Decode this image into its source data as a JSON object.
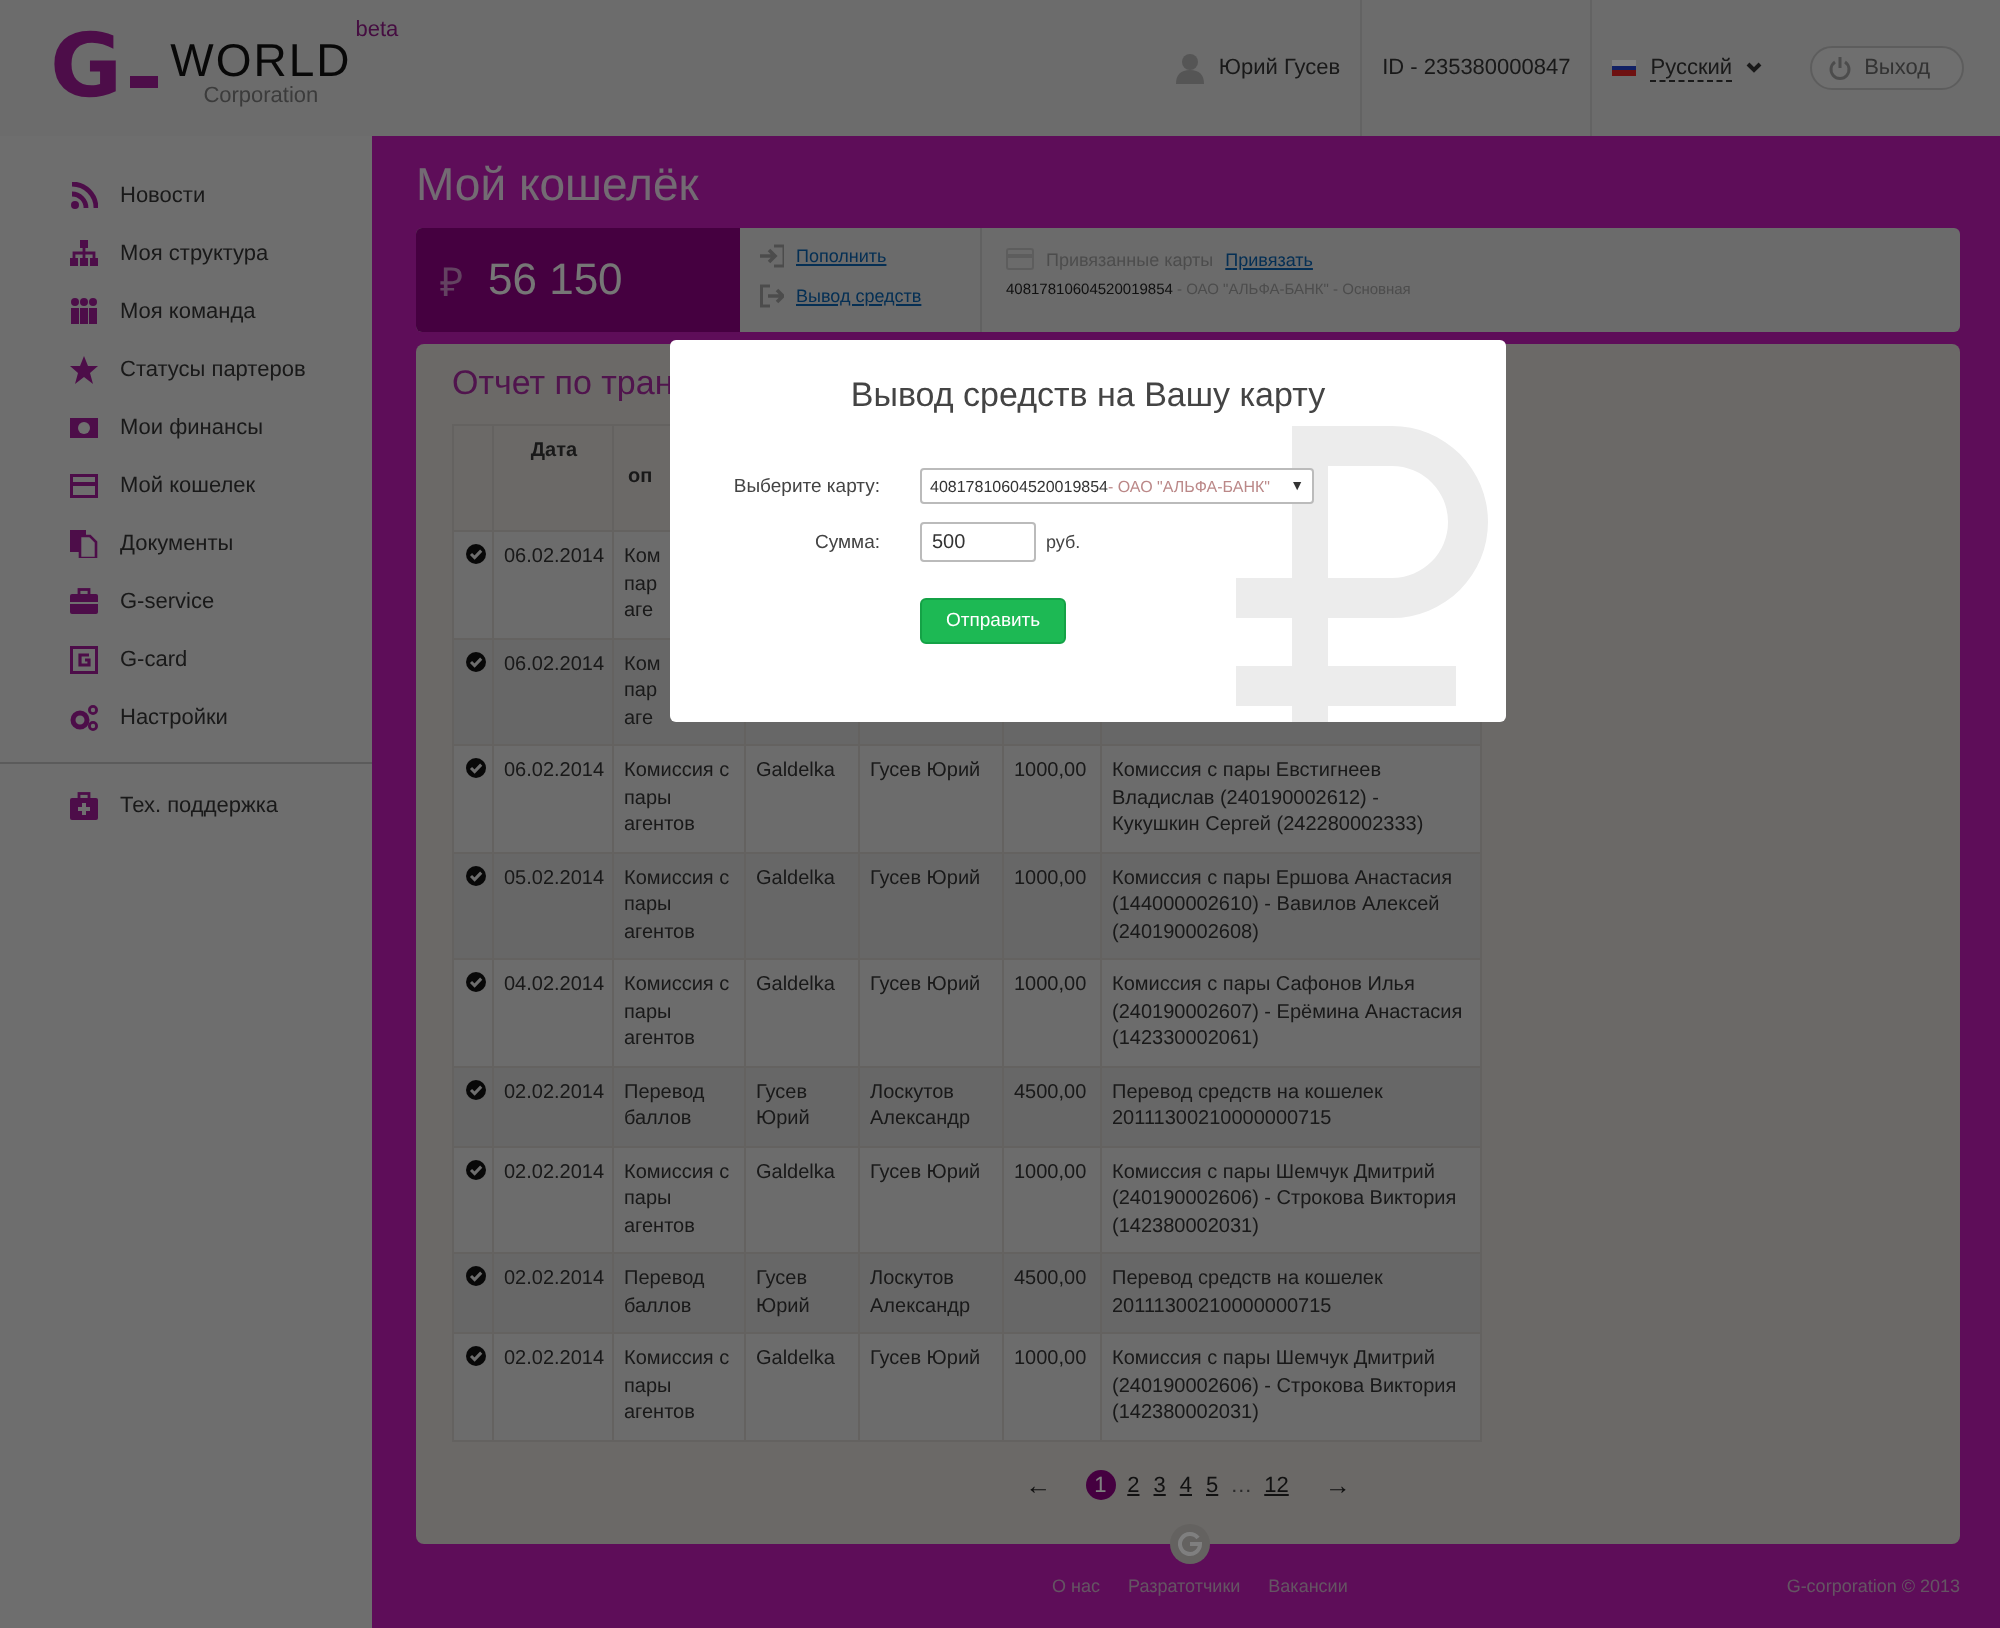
{
  "header": {
    "logo": {
      "letter": "G",
      "name": "WORLD",
      "subtitle": "Corporation",
      "badge": "beta"
    },
    "user": "Юрий Гусев",
    "id": "ID - 235380000847",
    "language": "Русский",
    "logout": "Выход"
  },
  "sidebar": {
    "items": [
      {
        "label": "Новости"
      },
      {
        "label": "Моя структура"
      },
      {
        "label": "Моя команда"
      },
      {
        "label": "Статусы партеров"
      },
      {
        "label": "Мои финансы"
      },
      {
        "label": "Мой кошелек"
      },
      {
        "label": "Документы"
      },
      {
        "label": "G-service"
      },
      {
        "label": "G-card"
      },
      {
        "label": "Настройки"
      }
    ],
    "support": "Тех. поддержка"
  },
  "page_title": "Мой кошелёк",
  "balance": {
    "currency": "₽",
    "amount": "56 150"
  },
  "actions": [
    "Пополнить",
    "Вывод средств"
  ],
  "cards": {
    "label": "Привязанные карты",
    "link": "Привязать",
    "number": "40817810604520019854",
    "details": " - ОАО \"АЛЬФА-БАНК\" - Основная"
  },
  "report": {
    "title": "Отчет по тран",
    "columns": [
      "Дата",
      "оп"
    ],
    "rows": [
      {
        "date": "06.02.2014",
        "operation": "Ком\nпар\nаге"
      },
      {
        "date": "06.02.2014",
        "operation": "Ком\nпар\nаге"
      },
      {
        "date": "06.02.2014",
        "operation": "Комиссия с пары агентов",
        "from": "Galdelka",
        "to": "Гусев Юрий",
        "amount": "1000,00",
        "comment": "Комиссия с пары Евстигнеев Владислав (240190002612) - Кукушкин Сергей (242280002333)"
      },
      {
        "date": "05.02.2014",
        "operation": "Комиссия с пары агентов",
        "from": "Galdelka",
        "to": "Гусев Юрий",
        "amount": "1000,00",
        "comment": "Комиссия с пары Ершова Анастасия (144000002610) - Вавилов Алексей (240190002608)"
      },
      {
        "date": "04.02.2014",
        "operation": "Комиссия с пары агентов",
        "from": "Galdelka",
        "to": "Гусев Юрий",
        "amount": "1000,00",
        "comment": "Комиссия с пары Сафонов Илья (240190002607) - Ерёмина Анастасия (142330002061)"
      },
      {
        "date": "02.02.2014",
        "operation": "Перевод баллов",
        "from": "Гусев Юрий",
        "to": "Лоскутов Александр",
        "amount": "4500,00",
        "comment": "Перевод средств на кошелек 20111300210000000715"
      },
      {
        "date": "02.02.2014",
        "operation": "Комиссия с пары агентов",
        "from": "Galdelka",
        "to": "Гусев Юрий",
        "amount": "1000,00",
        "comment": "Комиссия с пары Шемчук Дмитрий (240190002606) - Строкова Виктория (142380002031)"
      },
      {
        "date": "02.02.2014",
        "operation": "Перевод баллов",
        "from": "Гусев Юрий",
        "to": "Лоскутов Александр",
        "amount": "4500,00",
        "comment": "Перевод средств на кошелек 20111300210000000715"
      },
      {
        "date": "02.02.2014",
        "operation": "Комиссия с пары агентов",
        "from": "Galdelka",
        "to": "Гусев Юрий",
        "amount": "1000,00",
        "comment": "Комиссия с пары Шемчук Дмитрий (240190002606) - Строкова Виктория (142380002031)"
      }
    ]
  },
  "pagination": {
    "prev": "←",
    "next": "→",
    "pages": [
      {
        "label": "1",
        "selected": true
      },
      {
        "label": "2",
        "selected": false
      },
      {
        "label": "3",
        "selected": false
      },
      {
        "label": "4",
        "selected": false
      },
      {
        "label": "5",
        "selected": false
      },
      {
        "label": "…",
        "kind": "gap"
      },
      {
        "label": "12",
        "selected": false
      }
    ]
  },
  "footer": {
    "links": [
      "О нас",
      "Разратотчики",
      "Вакансии"
    ],
    "copyright": "G-corporation © 2013"
  },
  "modal": {
    "title": "Вывод средств на Вашу карту",
    "card_label": "Выберите карту:",
    "card_number": "40817810604520019854",
    "card_bank": " - ОАО \"АЛЬФА-БАНК\"",
    "caret": "▼",
    "amount_label": "Сумма:",
    "amount": "500",
    "unit": "руб.",
    "submit": "Отправить"
  }
}
